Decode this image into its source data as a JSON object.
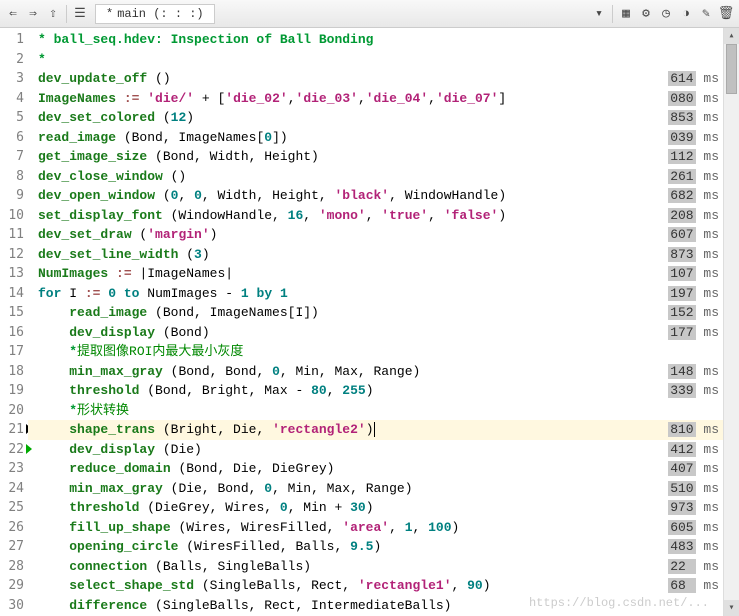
{
  "toolbar": {
    "tab_name": "main (: : :)",
    "tab_dirty": "*"
  },
  "icons": {
    "back": "⇐",
    "fwd": "⇒",
    "up": "⇧",
    "fold": "☰",
    "i1": "▦",
    "i2": "⚙",
    "i3": "◷",
    "i4": "◑",
    "i5": "✎",
    "i6": "🗑"
  },
  "lines": [
    {
      "n": 1,
      "seg": [
        {
          "c": "tok-com",
          "t": "* ball_seq.hdev: Inspection of Ball Bonding"
        }
      ]
    },
    {
      "n": 2,
      "seg": [
        {
          "c": "tok-com",
          "t": "*"
        }
      ]
    },
    {
      "n": 3,
      "time": "614",
      "seg": [
        {
          "c": "tok-op",
          "t": "dev_update_off"
        },
        {
          "c": "",
          "t": " ()"
        }
      ]
    },
    {
      "n": 4,
      "time": "080",
      "seg": [
        {
          "c": "tok-id",
          "t": "ImageNames"
        },
        {
          "c": "",
          "t": " "
        },
        {
          "c": "tok-assign",
          "t": ":="
        },
        {
          "c": "",
          "t": " "
        },
        {
          "c": "tok-str",
          "t": "'die/'"
        },
        {
          "c": "",
          "t": " + ["
        },
        {
          "c": "tok-str",
          "t": "'die_02'"
        },
        {
          "c": "",
          "t": ","
        },
        {
          "c": "tok-str",
          "t": "'die_03'"
        },
        {
          "c": "",
          "t": ","
        },
        {
          "c": "tok-str",
          "t": "'die_04'"
        },
        {
          "c": "",
          "t": ","
        },
        {
          "c": "tok-str",
          "t": "'die_07'"
        },
        {
          "c": "",
          "t": "]"
        }
      ]
    },
    {
      "n": 5,
      "time": "853",
      "seg": [
        {
          "c": "tok-op",
          "t": "dev_set_colored"
        },
        {
          "c": "",
          "t": " ("
        },
        {
          "c": "tok-num",
          "t": "12"
        },
        {
          "c": "",
          "t": ")"
        }
      ]
    },
    {
      "n": 6,
      "time": "039",
      "seg": [
        {
          "c": "tok-op",
          "t": "read_image"
        },
        {
          "c": "",
          "t": " (Bond, ImageNames["
        },
        {
          "c": "tok-num",
          "t": "0"
        },
        {
          "c": "",
          "t": "])"
        }
      ]
    },
    {
      "n": 7,
      "time": "112",
      "seg": [
        {
          "c": "tok-op",
          "t": "get_image_size"
        },
        {
          "c": "",
          "t": " (Bond, Width, Height)"
        }
      ]
    },
    {
      "n": 8,
      "time": "261",
      "seg": [
        {
          "c": "tok-op",
          "t": "dev_close_window"
        },
        {
          "c": "",
          "t": " ()"
        }
      ]
    },
    {
      "n": 9,
      "time": "682",
      "seg": [
        {
          "c": "tok-op",
          "t": "dev_open_window"
        },
        {
          "c": "",
          "t": " ("
        },
        {
          "c": "tok-num",
          "t": "0"
        },
        {
          "c": "",
          "t": ", "
        },
        {
          "c": "tok-num",
          "t": "0"
        },
        {
          "c": "",
          "t": ", Width, Height, "
        },
        {
          "c": "tok-str",
          "t": "'black'"
        },
        {
          "c": "",
          "t": ", WindowHandle)"
        }
      ]
    },
    {
      "n": 10,
      "time": "208",
      "seg": [
        {
          "c": "tok-op",
          "t": "set_display_font"
        },
        {
          "c": "",
          "t": " (WindowHandle, "
        },
        {
          "c": "tok-num",
          "t": "16"
        },
        {
          "c": "",
          "t": ", "
        },
        {
          "c": "tok-str",
          "t": "'mono'"
        },
        {
          "c": "",
          "t": ", "
        },
        {
          "c": "tok-str",
          "t": "'true'"
        },
        {
          "c": "",
          "t": ", "
        },
        {
          "c": "tok-str",
          "t": "'false'"
        },
        {
          "c": "",
          "t": ")"
        }
      ]
    },
    {
      "n": 11,
      "time": "607",
      "seg": [
        {
          "c": "tok-op",
          "t": "dev_set_draw"
        },
        {
          "c": "",
          "t": " ("
        },
        {
          "c": "tok-str",
          "t": "'margin'"
        },
        {
          "c": "",
          "t": ")"
        }
      ]
    },
    {
      "n": 12,
      "time": "873",
      "seg": [
        {
          "c": "tok-op",
          "t": "dev_set_line_width"
        },
        {
          "c": "",
          "t": " ("
        },
        {
          "c": "tok-num",
          "t": "3"
        },
        {
          "c": "",
          "t": ")"
        }
      ]
    },
    {
      "n": 13,
      "time": "107",
      "seg": [
        {
          "c": "tok-id",
          "t": "NumImages"
        },
        {
          "c": "",
          "t": " "
        },
        {
          "c": "tok-assign",
          "t": ":="
        },
        {
          "c": "",
          "t": " |ImageNames|"
        }
      ]
    },
    {
      "n": 14,
      "time": "197",
      "seg": [
        {
          "c": "tok-kw",
          "t": "for"
        },
        {
          "c": "",
          "t": " I "
        },
        {
          "c": "tok-assign",
          "t": ":="
        },
        {
          "c": "",
          "t": " "
        },
        {
          "c": "tok-num",
          "t": "0"
        },
        {
          "c": "",
          "t": " "
        },
        {
          "c": "tok-kw",
          "t": "to"
        },
        {
          "c": "",
          "t": " NumImages - "
        },
        {
          "c": "tok-num",
          "t": "1"
        },
        {
          "c": "",
          "t": " "
        },
        {
          "c": "tok-kw",
          "t": "by"
        },
        {
          "c": "",
          "t": " "
        },
        {
          "c": "tok-num",
          "t": "1"
        }
      ]
    },
    {
      "n": 15,
      "time": "152",
      "indent": 1,
      "seg": [
        {
          "c": "tok-op",
          "t": "read_image"
        },
        {
          "c": "",
          "t": " (Bond, ImageNames[I])"
        }
      ]
    },
    {
      "n": 16,
      "time": "177",
      "indent": 1,
      "seg": [
        {
          "c": "tok-op",
          "t": "dev_display"
        },
        {
          "c": "",
          "t": " (Bond)"
        }
      ]
    },
    {
      "n": 17,
      "indent": 1,
      "seg": [
        {
          "c": "tok-com",
          "t": "*"
        },
        {
          "c": "tok-cjk",
          "t": "提取图像ROI内最大最小灰度"
        }
      ]
    },
    {
      "n": 18,
      "time": "148",
      "indent": 1,
      "seg": [
        {
          "c": "tok-op",
          "t": "min_max_gray"
        },
        {
          "c": "",
          "t": " (Bond, Bond, "
        },
        {
          "c": "tok-num",
          "t": "0"
        },
        {
          "c": "",
          "t": ", Min, Max, Range)"
        }
      ]
    },
    {
      "n": 19,
      "time": "339",
      "indent": 1,
      "seg": [
        {
          "c": "tok-op",
          "t": "threshold"
        },
        {
          "c": "",
          "t": " (Bond, Bright, Max - "
        },
        {
          "c": "tok-num",
          "t": "80"
        },
        {
          "c": "",
          "t": ", "
        },
        {
          "c": "tok-num",
          "t": "255"
        },
        {
          "c": "",
          "t": ")"
        }
      ]
    },
    {
      "n": 20,
      "indent": 1,
      "seg": [
        {
          "c": "tok-com",
          "t": "*"
        },
        {
          "c": "tok-cjk",
          "t": "形状转换"
        }
      ]
    },
    {
      "n": 21,
      "time": "810",
      "indent": 1,
      "cur": true,
      "bp": true,
      "seg": [
        {
          "c": "tok-op",
          "t": "shape_trans"
        },
        {
          "c": "",
          "t": " (Bright, Die, "
        },
        {
          "c": "tok-str",
          "t": "'rectangle2'"
        },
        {
          "c": "",
          "t": ")"
        },
        {
          "caret": true
        }
      ]
    },
    {
      "n": 22,
      "time": "412",
      "indent": 1,
      "pc": true,
      "seg": [
        {
          "c": "tok-op",
          "t": "dev_display"
        },
        {
          "c": "",
          "t": " (Die)"
        }
      ]
    },
    {
      "n": 23,
      "time": "407",
      "indent": 1,
      "seg": [
        {
          "c": "tok-op",
          "t": "reduce_domain"
        },
        {
          "c": "",
          "t": " (Bond, Die, DieGrey)"
        }
      ]
    },
    {
      "n": 24,
      "time": "510",
      "indent": 1,
      "seg": [
        {
          "c": "tok-op",
          "t": "min_max_gray"
        },
        {
          "c": "",
          "t": " (Die, Bond, "
        },
        {
          "c": "tok-num",
          "t": "0"
        },
        {
          "c": "",
          "t": ", Min, Max, Range)"
        }
      ]
    },
    {
      "n": 25,
      "time": "973",
      "indent": 1,
      "seg": [
        {
          "c": "tok-op",
          "t": "threshold"
        },
        {
          "c": "",
          "t": " (DieGrey, Wires, "
        },
        {
          "c": "tok-num",
          "t": "0"
        },
        {
          "c": "",
          "t": ", Min + "
        },
        {
          "c": "tok-num",
          "t": "30"
        },
        {
          "c": "",
          "t": ")"
        }
      ]
    },
    {
      "n": 26,
      "time": "605",
      "indent": 1,
      "seg": [
        {
          "c": "tok-op",
          "t": "fill_up_shape"
        },
        {
          "c": "",
          "t": " (Wires, WiresFilled, "
        },
        {
          "c": "tok-str",
          "t": "'area'"
        },
        {
          "c": "",
          "t": ", "
        },
        {
          "c": "tok-num",
          "t": "1"
        },
        {
          "c": "",
          "t": ", "
        },
        {
          "c": "tok-num",
          "t": "100"
        },
        {
          "c": "",
          "t": ")"
        }
      ]
    },
    {
      "n": 27,
      "time": "483",
      "indent": 1,
      "seg": [
        {
          "c": "tok-op",
          "t": "opening_circle"
        },
        {
          "c": "",
          "t": " (WiresFilled, Balls, "
        },
        {
          "c": "tok-num",
          "t": "9.5"
        },
        {
          "c": "",
          "t": ")"
        }
      ]
    },
    {
      "n": 28,
      "time": "22 ",
      "indent": 1,
      "seg": [
        {
          "c": "tok-op",
          "t": "connection"
        },
        {
          "c": "",
          "t": " (Balls, SingleBalls)"
        }
      ]
    },
    {
      "n": 29,
      "time": "68 ",
      "indent": 1,
      "seg": [
        {
          "c": "tok-op",
          "t": "select_shape_std"
        },
        {
          "c": "",
          "t": " (SingleBalls, Rect, "
        },
        {
          "c": "tok-str",
          "t": "'rectangle1'"
        },
        {
          "c": "",
          "t": ", "
        },
        {
          "c": "tok-num",
          "t": "90"
        },
        {
          "c": "",
          "t": ")"
        }
      ]
    },
    {
      "n": 30,
      "indent": 1,
      "seg": [
        {
          "c": "tok-op",
          "t": "difference"
        },
        {
          "c": "",
          "t": " (SingleBalls, Rect, IntermediateBalls)"
        }
      ]
    }
  ],
  "time_unit": "ms",
  "watermark": "https://blog.csdn.net/..."
}
